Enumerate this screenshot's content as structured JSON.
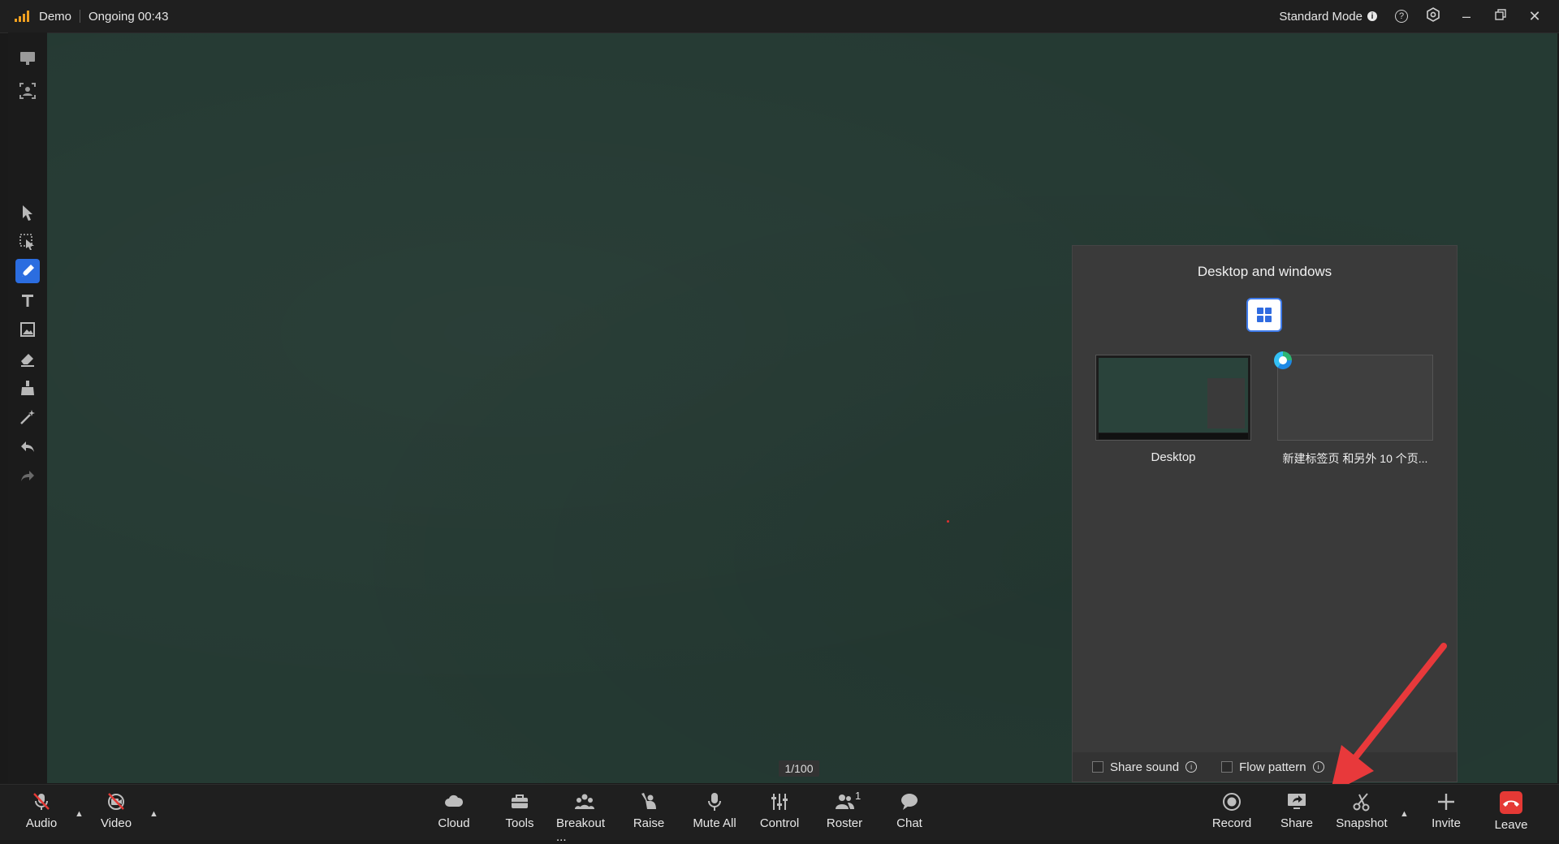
{
  "titlebar": {
    "app_name": "Demo",
    "status": "Ongoing 00:43",
    "mode": "Standard Mode",
    "mode_info_icon": "i",
    "help_icon": "?"
  },
  "board": {
    "page_counter": "1/100"
  },
  "share_panel": {
    "title": "Desktop and windows",
    "items": [
      {
        "label": "Desktop"
      },
      {
        "label": "新建标签页 和另外 10 个页..."
      }
    ],
    "options": {
      "share_sound": "Share sound",
      "flow_pattern": "Flow pattern"
    }
  },
  "toolbar": {
    "audio": "Audio",
    "video": "Video",
    "cloud": "Cloud",
    "tools": "Tools",
    "breakout": "Breakout ...",
    "raise": "Raise",
    "mute_all": "Mute All",
    "control": "Control",
    "roster": "Roster",
    "roster_count": "1",
    "chat": "Chat",
    "record": "Record",
    "share": "Share",
    "snapshot": "Snapshot",
    "invite": "Invite",
    "leave": "Leave"
  },
  "colors": {
    "accent": "#2f6be0",
    "board": "#253a33",
    "leave": "#e53935",
    "signal": "#f0a020",
    "annotation_arrow": "#e8393b"
  }
}
